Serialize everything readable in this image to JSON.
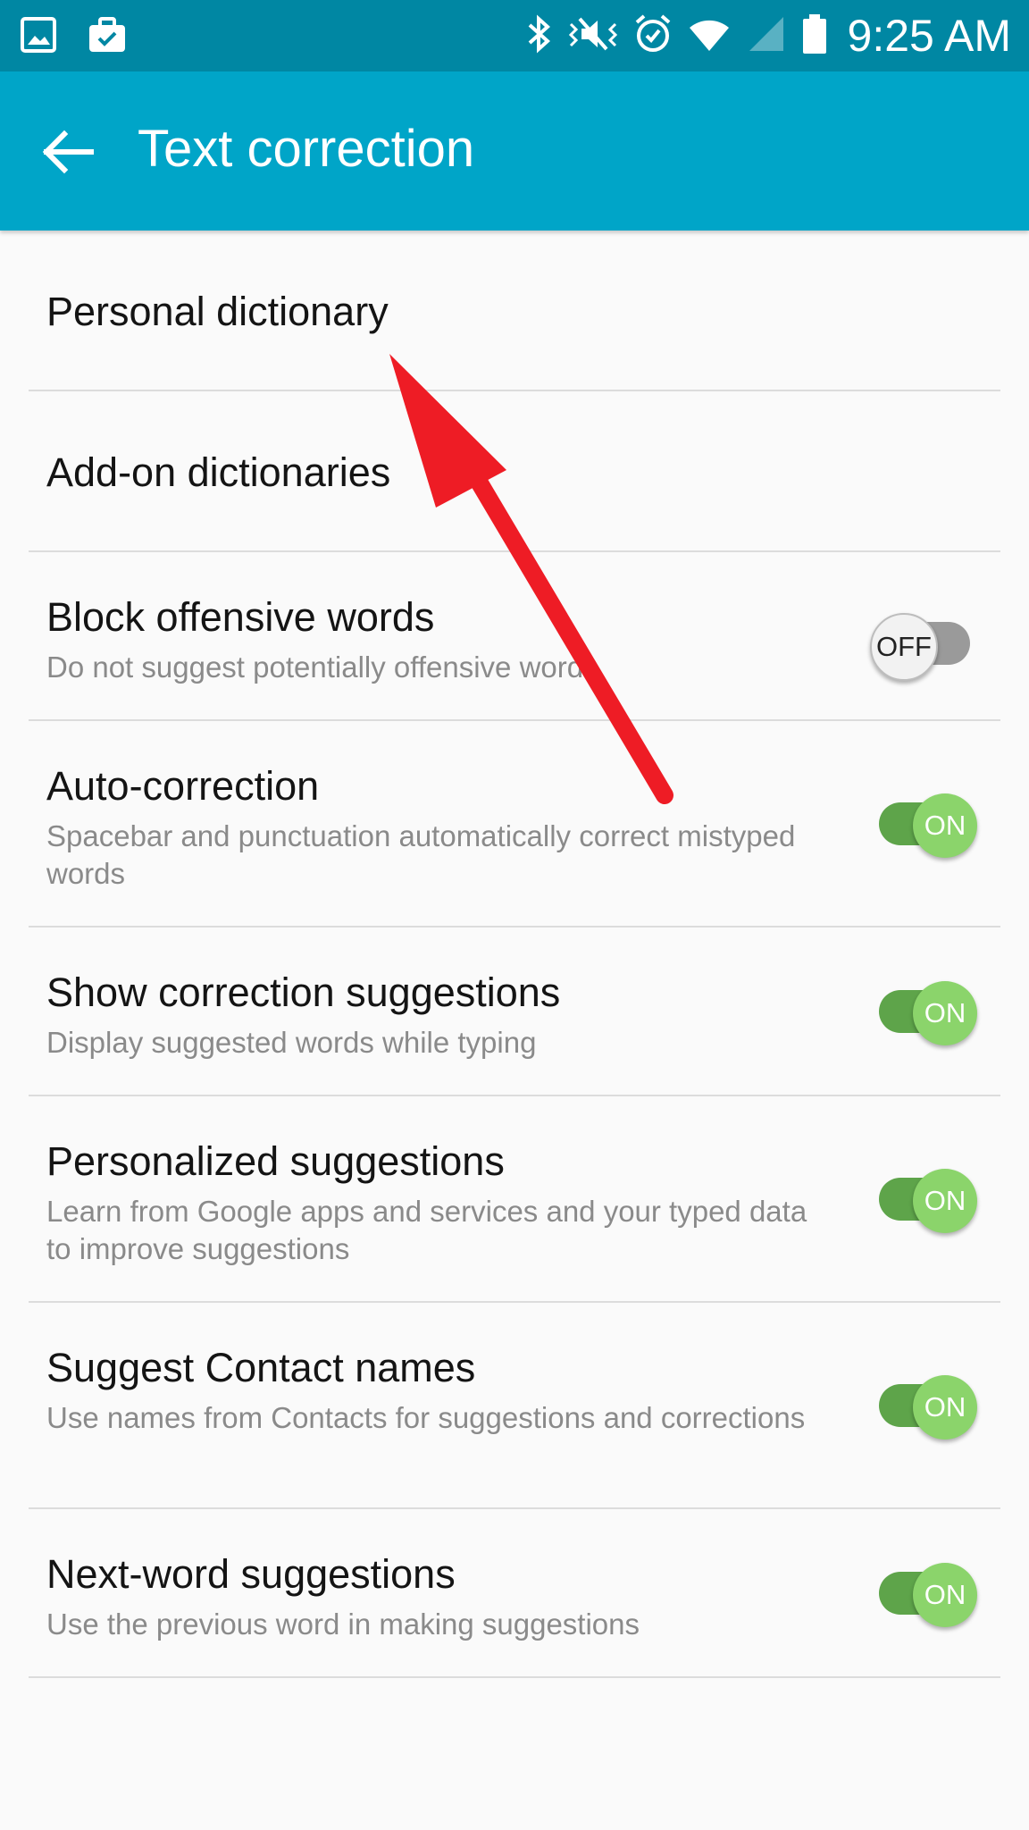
{
  "status_bar": {
    "time": "9:25 AM",
    "icons": [
      "gallery-icon",
      "briefcase-icon",
      "bluetooth-icon",
      "vibrate-icon",
      "alarm-icon",
      "wifi-icon",
      "signal-icon",
      "battery-icon"
    ]
  },
  "app_bar": {
    "title": "Text correction",
    "back_icon": "arrow-left-icon",
    "background": "#00a5c8"
  },
  "settings": [
    {
      "title": "Personal dictionary"
    },
    {
      "title": "Add-on dictionaries"
    },
    {
      "title": "Block offensive words",
      "subtitle": "Do not suggest potentially offensive words",
      "toggle": "OFF"
    },
    {
      "title": "Auto-correction",
      "subtitle": "Spacebar and punctuation automatically correct mistyped words",
      "toggle": "ON"
    },
    {
      "title": "Show correction suggestions",
      "subtitle": "Display suggested words while typing",
      "toggle": "ON"
    },
    {
      "title": "Personalized suggestions",
      "subtitle": "Learn from Google apps and services and your typed data to improve suggestions",
      "toggle": "ON"
    },
    {
      "title": "Suggest Contact names",
      "subtitle": "Use names from Contacts for suggestions and corrections",
      "toggle": "ON"
    },
    {
      "title": "Next-word suggestions",
      "subtitle": "Use the previous word in making suggestions",
      "toggle": "ON"
    }
  ],
  "colors": {
    "status_bar": "#0087a3",
    "toggle_on": "#8bd46b",
    "annotation_arrow": "#ee1c25"
  }
}
